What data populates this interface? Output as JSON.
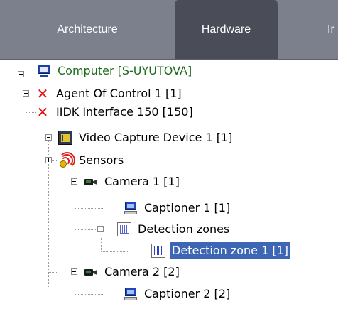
{
  "tabs": [
    {
      "label": "Architecture",
      "active": false
    },
    {
      "label": "Hardware",
      "active": true
    },
    {
      "label": "Ir",
      "active": false
    }
  ],
  "tree": {
    "computer": {
      "label": "Computer [S-UYUTOVA]",
      "icon": "computer-icon"
    },
    "agent": {
      "label": "Agent Of Control 1 [1]",
      "icon": "error-x-icon"
    },
    "iidk": {
      "label": "IIDK Interface 150 [150]",
      "icon": "error-x-icon"
    },
    "vcd": {
      "label": "Video Capture Device 1 [1]",
      "icon": "capture-board-icon"
    },
    "sensors": {
      "label": "Sensors",
      "icon": "sensor-icon"
    },
    "camera1": {
      "label": "Camera 1 [1]",
      "icon": "camera-icon"
    },
    "captioner1": {
      "label": "Captioner 1 [1]",
      "icon": "captioner-icon"
    },
    "zones": {
      "label": "Detection zones",
      "icon": "detection-zones-icon"
    },
    "zone1": {
      "label": "Detection zone 1 [1]",
      "icon": "detection-zone-icon",
      "selected": true
    },
    "camera2": {
      "label": "Camera 2 [2]",
      "icon": "camera-icon"
    },
    "captioner2": {
      "label": "Captioner 2 [2]",
      "icon": "captioner-icon"
    }
  },
  "colors": {
    "tabbar": "#7c808d",
    "active_tab": "#4a4d57",
    "selection": "#3d67b5",
    "computer_label": "#1d6b1d"
  }
}
